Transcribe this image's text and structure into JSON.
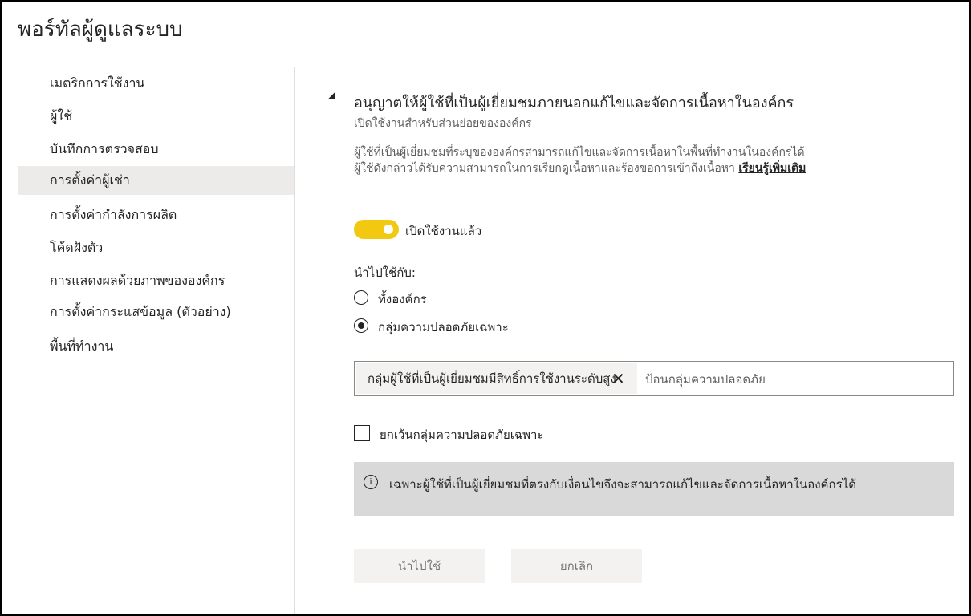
{
  "header": {
    "title": "พอร์ทัลผู้ดูแลระบบ"
  },
  "sidebar": {
    "items": [
      {
        "label": "เมตริกการใช้งาน"
      },
      {
        "label": "ผู้ใช้"
      },
      {
        "label": "บันทึกการตรวจสอบ"
      },
      {
        "label": "การตั้งค่าผู้เช่า",
        "active": true
      },
      {
        "label": "การตั้งค่ากำลังการผลิต"
      },
      {
        "label": "โค้ดฝังตัว"
      },
      {
        "label": "การแสดงผลด้วยภาพขององค์กร"
      },
      {
        "label": "การตั้งค่ากระแสข้อมูล (ตัวอย่าง)"
      },
      {
        "label": "พื้นที่ทำงาน"
      }
    ]
  },
  "setting": {
    "toggle_icon": "collapse-triangle",
    "toggle_glyph": "◢",
    "title": "อนุญาตให้ผู้ใช้ที่เป็นผู้เยี่ยมชมภายนอกแก้ไขและจัดการเนื้อหาในองค์กร",
    "subtitle": "เปิดใช้งานสำหรับส่วนย่อยขององค์กร",
    "description_line1": "ผู้ใช้ที่เป็นผู้เยี่ยมชมที่ระบุขององค์กรสามารถแก้ไขและจัดการเนื้อหาในพื้นที่ทำงานในองค์กรได้",
    "description_line2": "ผู้ใช้ดังกล่าวได้รับความสามารถในการเรียกดูเนื้อหาและร้องขอการเข้าถึงเนื้อหา",
    "learn_more": "เรียนรู้เพิ่มเติม",
    "enabled": true,
    "enabled_label": "เปิดใช้งานแล้ว",
    "apply_to_label": "นำไปใช้กับ:",
    "options": [
      {
        "label": "ทั้งองค์กร",
        "selected": false
      },
      {
        "label": "กลุ่มความปลอดภัยเฉพาะ",
        "selected": true
      }
    ],
    "group_chip": "กลุ่มผู้ใช้ที่เป็นผู้เยี่ยมชมมีสิทธิ์การใช้งานระดับสูง",
    "group_input_placeholder": "ป้อนกลุ่มความปลอดภัย",
    "except_label": "ยกเว้นกลุ่มความปลอดภัยเฉพาะ",
    "except_checked": false,
    "info_icon": "info-icon",
    "info_text": "เฉพาะผู้ใช้ที่เป็นผู้เยี่ยมชมที่ตรงกับเงื่อนไขจึงจะสามารถแก้ไขและจัดการเนื้อหาในองค์กรได้"
  },
  "buttons": {
    "apply": "นำไปใช้",
    "cancel": "ยกเลิก"
  },
  "colors": {
    "toggle_on": "#f2c811",
    "active_item": "#edebe9",
    "info_bg": "#d9d9d9"
  }
}
